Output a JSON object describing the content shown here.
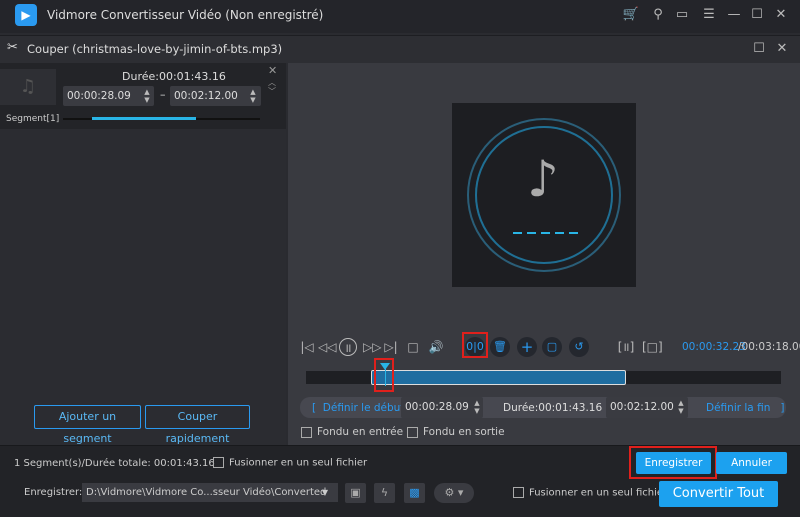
{
  "app": {
    "title": "Vidmore Convertisseur Vidéo (Non enregistré)",
    "icons": [
      "cart-icon",
      "key-icon",
      "feedback-icon",
      "menu-icon",
      "minimize-icon",
      "maximize-icon",
      "close-icon"
    ]
  },
  "cut": {
    "title": "Couper (christmas-love-by-jimin-of-bts.mp3)"
  },
  "segment": {
    "label": "Segment[1]",
    "duration": "Durée:00:01:43.16",
    "start": "00:00:28.09",
    "dash": "–",
    "end": "00:02:12.00",
    "progress": 0.46
  },
  "left_buttons": {
    "add_segment": "Ajouter un segment",
    "quick_cut": "Couper rapidement"
  },
  "player": {
    "current_time": "00:00:32.23",
    "total_time": "/00:03:18.00"
  },
  "timeline": {
    "set_start": "[  Définir le début",
    "start": "00:00:28.09",
    "duration": "Durée:00:01:43.16",
    "end": "00:02:12.00",
    "set_end": "Définir la fin   ]"
  },
  "fade": {
    "in": "Fondu en entrée",
    "out": "Fondu en sortie"
  },
  "footer": {
    "summary": "1 Segment(s)/Durée totale: 00:01:43.16",
    "merge": "Fusionner en un seul fichier",
    "save": "Enregistrer",
    "cancel": "Annuler",
    "save_label": "Enregistrer:",
    "path": "D:\\Vidmore\\Vidmore Co...sseur Vidéo\\Converted",
    "merge2": "Fusionner en un seul fichier",
    "convert_all": "Convertir Tout"
  },
  "colors": {
    "accent": "#1ca1ef",
    "highlight": "#e0201c"
  }
}
